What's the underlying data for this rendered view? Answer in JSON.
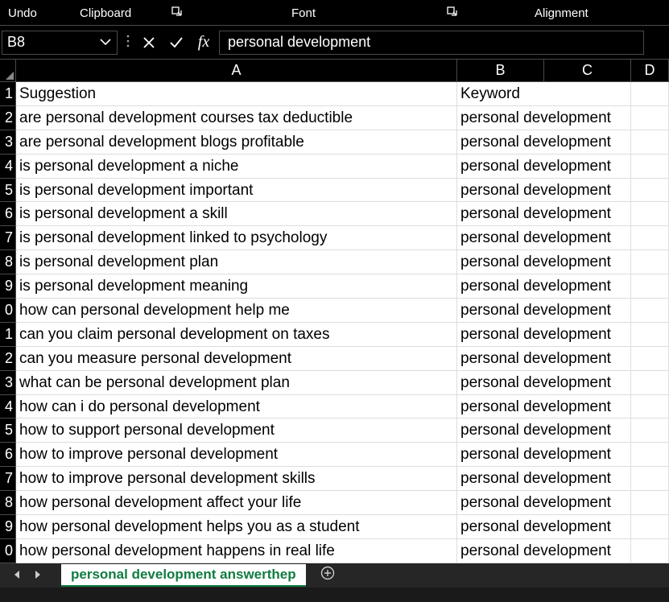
{
  "ribbon": {
    "groups": {
      "undo": "Undo",
      "clipboard": "Clipboard",
      "font": "Font",
      "alignment": "Alignment"
    }
  },
  "formula_bar": {
    "name_box": "B8",
    "fx_label": "fx",
    "formula": "personal development"
  },
  "columns": [
    {
      "id": "A",
      "label": "A"
    },
    {
      "id": "B",
      "label": "B"
    },
    {
      "id": "C",
      "label": "C"
    },
    {
      "id": "D",
      "label": "D"
    }
  ],
  "row_numbers": [
    "1",
    "2",
    "3",
    "4",
    "5",
    "6",
    "7",
    "8",
    "9",
    "0",
    "1",
    "2",
    "3",
    "4",
    "5",
    "6",
    "7",
    "8",
    "9",
    "0"
  ],
  "headers": {
    "a": "Suggestion",
    "b": "Keyword"
  },
  "rows": [
    {
      "a": "are personal development courses tax deductible",
      "b": "personal development"
    },
    {
      "a": "are personal development blogs profitable",
      "b": "personal development"
    },
    {
      "a": "is personal development a niche",
      "b": "personal development"
    },
    {
      "a": "is personal development important",
      "b": "personal development"
    },
    {
      "a": "is personal development a skill",
      "b": "personal development"
    },
    {
      "a": "is personal development linked to psychology",
      "b": "personal development"
    },
    {
      "a": "is personal development plan",
      "b": "personal development"
    },
    {
      "a": "is personal development meaning",
      "b": "personal development"
    },
    {
      "a": "how can personal development help me",
      "b": "personal development"
    },
    {
      "a": "can you claim personal development on taxes",
      "b": "personal development"
    },
    {
      "a": "can you measure personal development",
      "b": "personal development"
    },
    {
      "a": "what can be personal development plan",
      "b": "personal development"
    },
    {
      "a": "how can i do personal development",
      "b": "personal development"
    },
    {
      "a": "how to support personal development",
      "b": "personal development"
    },
    {
      "a": "how to improve personal development",
      "b": "personal development"
    },
    {
      "a": "how to improve personal development skills",
      "b": "personal development"
    },
    {
      "a": "how personal development affect your life",
      "b": "personal development"
    },
    {
      "a": "how personal development helps you as a student",
      "b": "personal development"
    },
    {
      "a": "how personal development happens in real life",
      "b": "personal development"
    }
  ],
  "sheet": {
    "active_tab": "personal development answerthep"
  }
}
